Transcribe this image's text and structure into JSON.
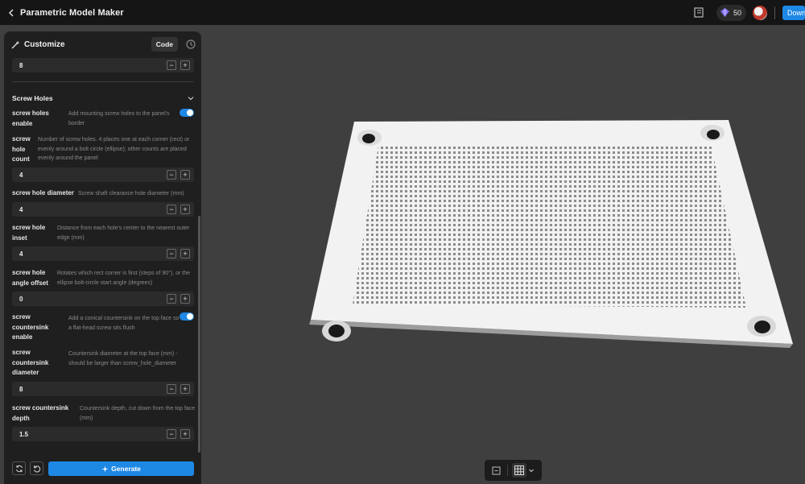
{
  "header": {
    "title": "Parametric Model Maker",
    "credits": "50",
    "download_label": "Download"
  },
  "panel": {
    "title": "Customize",
    "code_label": "Code",
    "top_input_value": "8",
    "section_title": "Screw Holes",
    "params": [
      {
        "label": "screw holes enable",
        "desc": "Add mounting screw holes to the panel's border",
        "type": "toggle",
        "enabled": true
      },
      {
        "label": "screw hole count",
        "desc": "Number of screw holes. 4 places one at each corner (rect) or evenly around a bolt circle (ellipse); other counts are placed evenly around the panel",
        "value": "4"
      },
      {
        "label": "screw hole diameter",
        "desc": "Screw shaft clearance hole diameter (mm)",
        "value": "4"
      },
      {
        "label": "screw hole inset",
        "desc": "Distance from each hole's center to the nearest outer edge (mm)",
        "value": "4"
      },
      {
        "label": "screw hole angle offset",
        "desc": "Rotates which rect corner is first (steps of 90°), or the ellipse bolt-circle start angle (degrees)",
        "value": "0"
      },
      {
        "label": "screw countersink enable",
        "desc": "Add a conical countersink on the top face so a flat-head screw sits flush",
        "type": "toggle",
        "enabled": true
      },
      {
        "label": "screw countersink diameter",
        "desc": "Countersink diameter at the top face (mm) - should be larger than screw_hole_diameter",
        "value": "8"
      },
      {
        "label": "screw countersink depth",
        "desc": "Countersink depth, cut down from the top face (mm)",
        "value": "1.5"
      }
    ],
    "minus": "−",
    "plus": "+",
    "generate_label": "Generate"
  },
  "colors": {
    "accent": "#1e88e5",
    "panel_bg": "#1f1f1f",
    "viewport_bg": "#3f3f3f"
  }
}
